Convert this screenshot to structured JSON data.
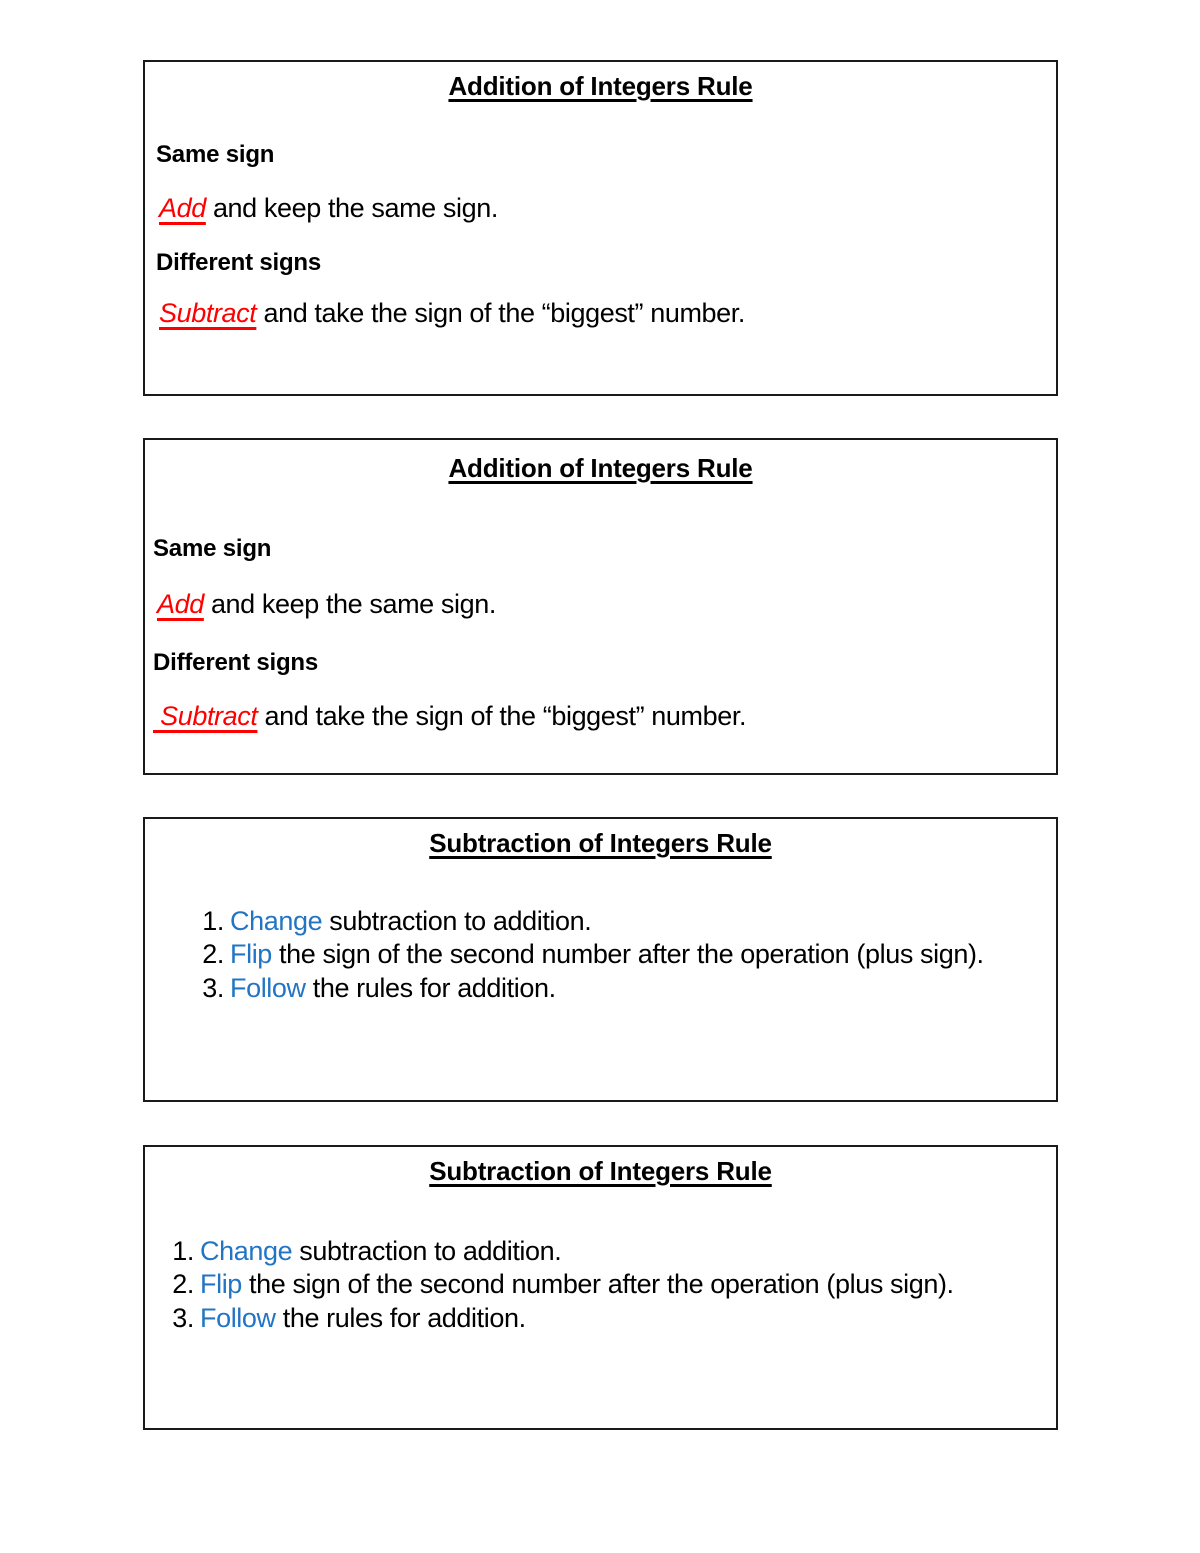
{
  "document": {
    "type": "worksheet",
    "background_color": "#ffffff",
    "accent_colors": {
      "keyword_red": "#ff0000",
      "keyword_blue": "#2175c4",
      "border": "#1a1a1a",
      "text": "#000000"
    }
  },
  "cards": [
    {
      "id": "addition-rule-1",
      "title": "Addition of Integers Rule",
      "heading_1": "Same sign",
      "line_1_keyword": "Add",
      "line_1_rest": " and keep the same sign.",
      "heading_2": "Different signs",
      "line_2_keyword": "Subtract",
      "line_2_rest": " and take the sign of the “biggest” number."
    },
    {
      "id": "addition-rule-2",
      "title": "Addition of Integers Rule",
      "heading_1": "Same sign",
      "line_1_keyword": "Add",
      "line_1_rest": " and keep the same sign.",
      "heading_2": "Different signs",
      "line_2_keyword": " Subtract",
      "line_2_rest": " and take the sign of the “biggest” number."
    },
    {
      "id": "subtraction-rule-1",
      "title": "Subtraction of Integers Rule",
      "items": [
        {
          "number": "1.",
          "keyword": "Change",
          "rest": " subtraction to addition."
        },
        {
          "number": "2.",
          "keyword": "Flip",
          "rest": " the sign of the second number after the operation (plus sign)."
        },
        {
          "number": "3.",
          "keyword": "Follow",
          "rest": " the rules for addition."
        }
      ]
    },
    {
      "id": "subtraction-rule-2",
      "title": "Subtraction of Integers Rule",
      "items": [
        {
          "number": "1.",
          "keyword": "Change",
          "rest": " subtraction to addition."
        },
        {
          "number": "2.",
          "keyword": "Flip",
          "rest": " the sign of the second number after the operation (plus sign)."
        },
        {
          "number": "3.",
          "keyword": "Follow",
          "rest": " the rules for addition."
        }
      ]
    }
  ]
}
